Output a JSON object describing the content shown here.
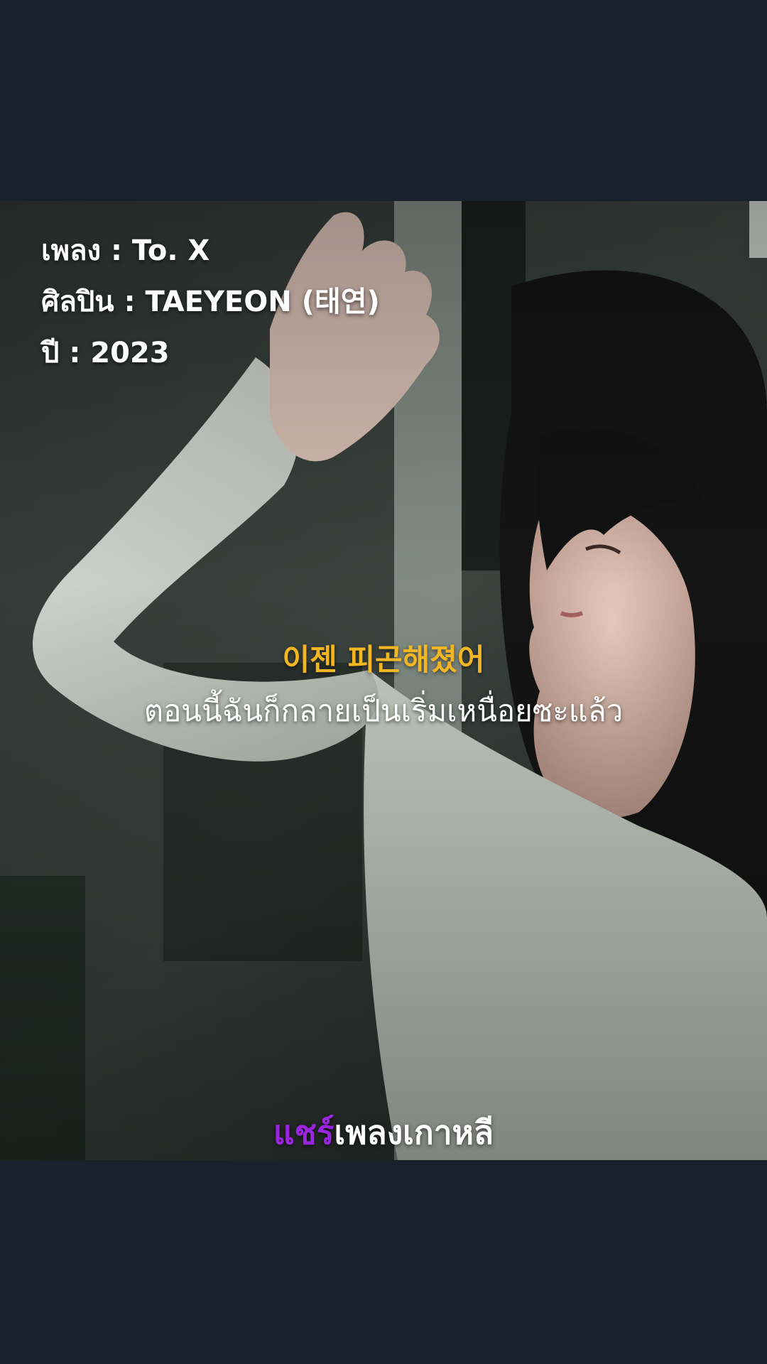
{
  "song_info": {
    "title_line": "เพลง : To. X",
    "artist_line": "ศิลปิน : TAEYEON (태연)",
    "year_line": "ปี : 2023"
  },
  "lyrics": {
    "korean": "이젠 피곤해졌어",
    "thai": "ตอนนี้ฉันก็กลายเป็นเริ่มเหนื่อยซะแล้ว"
  },
  "watermark": {
    "accent": "แชร์",
    "rest": "เพลงเกาหลี"
  },
  "colors": {
    "background": "#19212b",
    "korean_lyric": "#f2b622",
    "watermark_accent": "#9b24e0"
  }
}
